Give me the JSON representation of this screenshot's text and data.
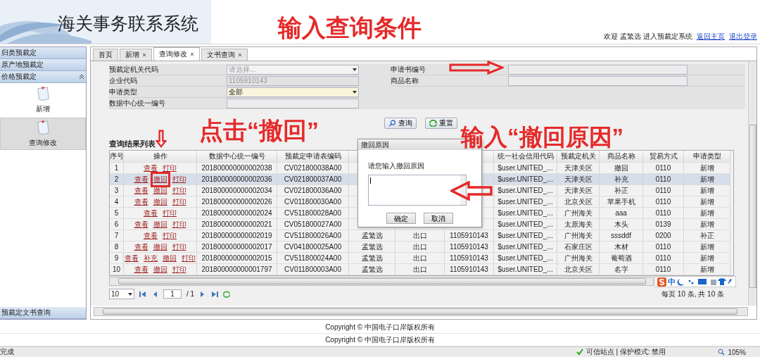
{
  "header": {
    "title": "海关事务联系系统",
    "welcome": "欢迎 孟繁选 进入预裁定系统",
    "links": [
      "返回主页",
      "退出登录"
    ]
  },
  "annotations": [
    "输入查询条件",
    "点击“撤回”",
    "输入“撤回原因”"
  ],
  "sidebar": {
    "groups": [
      {
        "label": "归类预裁定",
        "expanded": false
      },
      {
        "label": "原产地预裁定",
        "expanded": false
      },
      {
        "label": "价格预裁定",
        "expanded": true,
        "items": [
          {
            "label": "新增",
            "selected": false
          },
          {
            "label": "查询修改",
            "selected": true
          }
        ]
      }
    ],
    "footer_item": "预裁定文书查询"
  },
  "tabs": [
    {
      "label": "首页",
      "closable": false,
      "selected": false
    },
    {
      "label": "新增",
      "closable": true,
      "selected": false
    },
    {
      "label": "查询修改",
      "closable": true,
      "selected": true
    },
    {
      "label": "文书查询",
      "closable": true,
      "selected": false
    }
  ],
  "form": {
    "left": [
      {
        "label": "预裁定机关代码",
        "kind": "select",
        "placeholder": "请选择..."
      },
      {
        "label": "企业代码",
        "kind": "readonly",
        "value": "1105910143"
      },
      {
        "label": "申请类型",
        "kind": "select",
        "value": "全部"
      },
      {
        "label": "数据中心统一编号",
        "kind": "text"
      }
    ],
    "right": [
      {
        "label": "申请书编号",
        "kind": "text"
      },
      {
        "label": "商品名称",
        "kind": "text"
      }
    ]
  },
  "buttons": [
    {
      "label": "查询",
      "kind": "search"
    },
    {
      "label": "重置",
      "kind": "reset"
    }
  ],
  "results": {
    "title": "查询结果列表",
    "columns": [
      "序号",
      "操作",
      "数据中心统一编号",
      "预裁定申请表编码",
      null,
      null,
      null,
      "统一社会信用代码",
      "预裁定机关",
      "商品名称",
      "贸易方式",
      "申请类型"
    ],
    "rows": [
      {
        "selected": false,
        "actions": [
          {
            "label": "查看",
            "highlighted": false
          },
          {
            "label": "打印",
            "highlighted": false
          }
        ],
        "cells": [
          "1",
          null,
          "201800000000002038",
          "CV021800038A00",
          null,
          null,
          null,
          "$user.UNITED_...",
          "天津关区",
          "撤回",
          "0110",
          "新增"
        ]
      },
      {
        "selected": true,
        "actions": [
          {
            "label": "查看",
            "highlighted": false
          },
          {
            "label": "撤回",
            "highlighted": true
          },
          {
            "label": "打印",
            "highlighted": false
          }
        ],
        "cells": [
          "2",
          null,
          "201800000000002036",
          "CV021800037A00",
          null,
          null,
          null,
          "$user.UNITED_...",
          "天津关区",
          "补充",
          "0110",
          "新增"
        ]
      },
      {
        "selected": false,
        "actions": [
          {
            "label": "查看",
            "highlighted": false
          },
          {
            "label": "撤回",
            "highlighted": false
          },
          {
            "label": "打印",
            "highlighted": false
          }
        ],
        "cells": [
          "3",
          null,
          "201800000000002034",
          "CV021800036A00",
          null,
          null,
          null,
          "$user.UNITED_...",
          "天津关区",
          "补正",
          "0110",
          "新增"
        ]
      },
      {
        "selected": false,
        "actions": [
          {
            "label": "查看",
            "highlighted": false
          },
          {
            "label": "撤回",
            "highlighted": false
          },
          {
            "label": "打印",
            "highlighted": false
          }
        ],
        "cells": [
          "4",
          null,
          "201800000000002026",
          "CV011800030A00",
          null,
          null,
          null,
          "$user.UNITED_...",
          "北京关区",
          "苹果手机",
          "0110",
          "新增"
        ]
      },
      {
        "selected": false,
        "actions": [
          {
            "label": "查看",
            "highlighted": false
          },
          {
            "label": "打印",
            "highlighted": false
          }
        ],
        "cells": [
          "5",
          null,
          "201800000000002024",
          "CV511800028A00",
          null,
          null,
          null,
          "$user.UNITED_...",
          "广州海关",
          "aaa",
          "0110",
          "新增"
        ]
      },
      {
        "selected": false,
        "actions": [
          {
            "label": "查看",
            "highlighted": false
          },
          {
            "label": "撤回",
            "highlighted": false
          },
          {
            "label": "打印",
            "highlighted": false
          }
        ],
        "cells": [
          "6",
          null,
          "201800000000002021",
          "CV051800027A00",
          null,
          null,
          null,
          "$user.UNITED_...",
          "太原海关",
          "木头",
          "0139",
          "新增"
        ]
      },
      {
        "selected": false,
        "actions": [
          {
            "label": "查看",
            "highlighted": false
          },
          {
            "label": "打印",
            "highlighted": false
          }
        ],
        "cells": [
          "7",
          null,
          "201800000000002019",
          "CV511800026A00",
          "孟繁选",
          "出口",
          "1105910143",
          "$user.UNITED_...",
          "广州海关",
          "sssddf",
          "0200",
          "补正"
        ]
      },
      {
        "selected": false,
        "actions": [
          {
            "label": "查看",
            "highlighted": false
          },
          {
            "label": "撤回",
            "highlighted": false
          },
          {
            "label": "打印",
            "highlighted": false
          }
        ],
        "cells": [
          "8",
          null,
          "201800000000002017",
          "CV041800025A00",
          "孟繁选",
          "出口",
          "1105910143",
          "$user.UNITED_...",
          "石家庄区",
          "木材",
          "0110",
          "新增"
        ]
      },
      {
        "selected": false,
        "actions": [
          {
            "label": "查看",
            "highlighted": false
          },
          {
            "label": "补充",
            "highlighted": false
          },
          {
            "label": "撤回",
            "highlighted": false
          },
          {
            "label": "打印",
            "highlighted": false
          }
        ],
        "cells": [
          "9",
          null,
          "201800000000002015",
          "CV511800024A00",
          "孟繁选",
          "出口",
          "1105910143",
          "$user.UNITED_...",
          "广州海关",
          "葡萄酒",
          "0110",
          "新增"
        ]
      },
      {
        "selected": false,
        "actions": [
          {
            "label": "查看",
            "highlighted": false
          },
          {
            "label": "撤回",
            "highlighted": false
          },
          {
            "label": "打印",
            "highlighted": false
          }
        ],
        "cells": [
          "10",
          null,
          "201800000000001797",
          "CV011800003A00",
          "孟繁选",
          "出口",
          "1105910143",
          "$user.UNITED_...",
          "北京关区",
          "名字",
          "0110",
          "新增"
        ]
      }
    ]
  },
  "dialog": {
    "title": "撤回原因",
    "prompt": "请您输入撤回原因",
    "buttons": [
      "确定",
      "取消"
    ]
  },
  "pager": {
    "page_size": "10",
    "page": "1",
    "total_pages": "/ 1",
    "summary": "每页 10 条, 共 10 条"
  },
  "ime": {
    "label": "中"
  },
  "footer": [
    "Copyright © 中国电子口岸版权所有",
    "Copyright © 中国电子口岸版权所有"
  ],
  "status_bar": {
    "status": "完成",
    "zone": "可信站点 | 保护模式: 禁用",
    "zoom": "105%"
  }
}
